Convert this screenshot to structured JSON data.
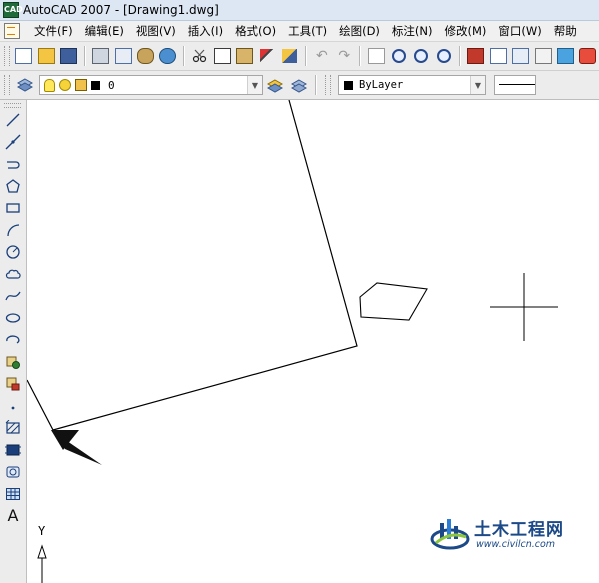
{
  "window": {
    "title": "AutoCAD 2007 - [Drawing1.dwg]",
    "app_icon_text": "CAD"
  },
  "menubar": {
    "items": [
      {
        "label": "文件(F)"
      },
      {
        "label": "编辑(E)"
      },
      {
        "label": "视图(V)"
      },
      {
        "label": "插入(I)"
      },
      {
        "label": "格式(O)"
      },
      {
        "label": "工具(T)"
      },
      {
        "label": "绘图(D)"
      },
      {
        "label": "标注(N)"
      },
      {
        "label": "修改(M)"
      },
      {
        "label": "窗口(W)"
      },
      {
        "label": "帮助"
      }
    ]
  },
  "layers_toolbar": {
    "current_layer": "0",
    "color_value": "ByLayer",
    "color_swatch": "#000000"
  },
  "drawing": {
    "ucs_y_label": "Y"
  },
  "watermark": {
    "title": "土木工程网",
    "url": "www.civilcn.com"
  },
  "colors": {
    "titlebar_bg": "#dde7f3",
    "toolbar_bg": "#ececec",
    "canvas_bg": "#ffffff",
    "watermark_blue": "#1c4a88"
  }
}
